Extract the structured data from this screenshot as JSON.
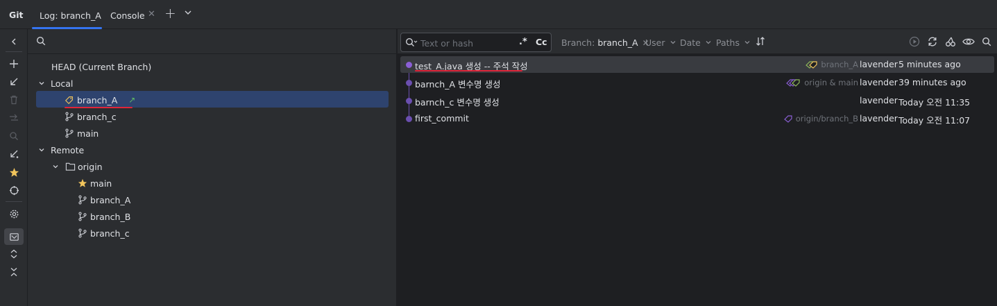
{
  "tool_window": {
    "title": "Git",
    "tabs": [
      {
        "label": "Log: branch_A",
        "active": true
      },
      {
        "label": "Console",
        "active": false
      }
    ]
  },
  "branches": {
    "search_placeholder": "",
    "head": "HEAD (Current Branch)",
    "local_label": "Local",
    "local": [
      {
        "name": "branch_A",
        "current": true,
        "icon": "tag-icon",
        "outgoing": "↗"
      },
      {
        "name": "branch_c",
        "icon": "branch-icon"
      },
      {
        "name": "main",
        "icon": "branch-icon"
      }
    ],
    "remote_label": "Remote",
    "remote_group": "origin",
    "remote": [
      {
        "name": "main",
        "icon": "star-icon"
      },
      {
        "name": "branch_A",
        "icon": "branch-icon"
      },
      {
        "name": "branch_B",
        "icon": "branch-icon"
      },
      {
        "name": "branch_c",
        "icon": "branch-icon"
      }
    ]
  },
  "log": {
    "filter": {
      "placeholder": "Text or hash",
      "regex_label": ".*",
      "case_label": "Cc",
      "branch_label": "Branch:",
      "branch_value": "branch_A",
      "user_label": "User",
      "date_label": "Date",
      "paths_label": "Paths"
    },
    "commits": [
      {
        "message": "test_A.java 생성 -- 주석 작성",
        "refs": "branch_A",
        "author": "lavender",
        "date": "5 minutes ago",
        "selected": true
      },
      {
        "message": "barnch_A 변수명 생성",
        "refs": "origin & main",
        "author": "lavender",
        "date": "39 minutes ago"
      },
      {
        "message": "barnch_c 변수명 생성",
        "refs": "",
        "author": "lavender",
        "date": "Today 오전 11:35"
      },
      {
        "message": "first_commit",
        "refs": "origin/branch_B",
        "author": "lavender",
        "date": "Today 오전 11:07"
      }
    ]
  },
  "colors": {
    "accent": "#3574f0",
    "selection": "#2e436e",
    "graph": "#8b5fd6",
    "highlight_underline": "#e0253a",
    "tag_green": "#8fb85a"
  }
}
